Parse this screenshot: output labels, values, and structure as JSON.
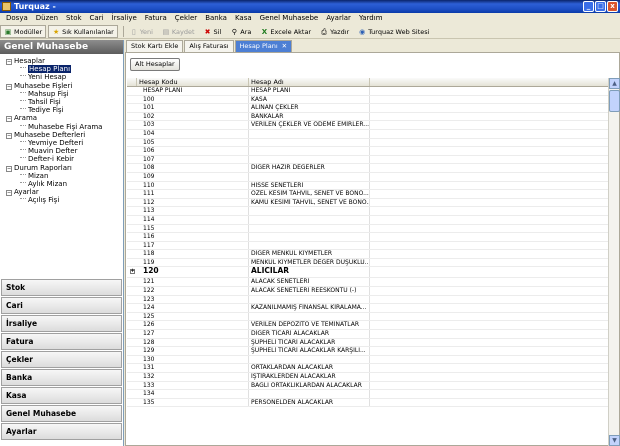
{
  "window": {
    "title": "Turquaz -",
    "buttons": {
      "minimize": "_",
      "maximize": "□",
      "close": "x"
    }
  },
  "menubar": [
    "Dosya",
    "Düzen",
    "Stok",
    "Cari",
    "İrsaliye",
    "Fatura",
    "Çekler",
    "Banka",
    "Kasa",
    "Genel Muhasebe",
    "Ayarlar",
    "Yardım"
  ],
  "toolbar": {
    "modules": "Modüller",
    "frequent": "Sık Kullanılanlar",
    "new": "Yeni",
    "save": "Kaydet",
    "delete": "Sil",
    "search": "Ara",
    "excel": "Excele Aktar",
    "print": "Yazdır",
    "website": "Turquaz Web Sitesi"
  },
  "left_panel": {
    "header": "Genel Muhasebe",
    "tree": [
      {
        "label": "Hesaplar",
        "level": 0,
        "toggle": "−"
      },
      {
        "label": "Hesap Planı",
        "level": 1,
        "selected": true
      },
      {
        "label": "Yeni Hesap",
        "level": 1
      },
      {
        "label": "Muhasebe Fişleri",
        "level": 0,
        "toggle": "−"
      },
      {
        "label": "Mahsup Fişi",
        "level": 1
      },
      {
        "label": "Tahsil Fişi",
        "level": 1
      },
      {
        "label": "Tediye Fişi",
        "level": 1
      },
      {
        "label": "Arama",
        "level": 0,
        "toggle": "−"
      },
      {
        "label": "Muhasebe Fişi Arama",
        "level": 1
      },
      {
        "label": "Muhasebe Defterleri",
        "level": 0,
        "toggle": "−"
      },
      {
        "label": "Yevmiye Defteri",
        "level": 1
      },
      {
        "label": "Muavin Defter",
        "level": 1
      },
      {
        "label": "Defter-i Kebir",
        "level": 1
      },
      {
        "label": "Durum Raporları",
        "level": 0,
        "toggle": "−"
      },
      {
        "label": "Mizan",
        "level": 1
      },
      {
        "label": "Aylık Mizan",
        "level": 1
      },
      {
        "label": "Ayarlar",
        "level": 0,
        "toggle": "−"
      },
      {
        "label": "Açılış Fişi",
        "level": 1
      }
    ],
    "modules": [
      "Stok",
      "Cari",
      "İrsaliye",
      "Fatura",
      "Çekler",
      "Banka",
      "Kasa",
      "Genel Muhasebe",
      "Ayarlar"
    ]
  },
  "doc_tabs": [
    {
      "label": "Stok Kartı Ekle",
      "active": false
    },
    {
      "label": "Alış Faturası",
      "active": false
    },
    {
      "label": "Hesap Planı",
      "active": true,
      "close": "✕"
    }
  ],
  "content": {
    "sub_button": "Alt Hesaplar",
    "columns": [
      "Hesap Kodu",
      "Hesap Adı"
    ],
    "rows": [
      [
        "HESAP PLANI",
        "HESAP PLANI"
      ],
      [
        "100",
        "KASA"
      ],
      [
        "101",
        "ALINAN ÇEKLER"
      ],
      [
        "102",
        "BANKALAR"
      ],
      [
        "103",
        "VERİLEN ÇEKLER VE ÖDEME EMİRLER..."
      ],
      [
        "104",
        ""
      ],
      [
        "105",
        ""
      ],
      [
        "106",
        ""
      ],
      [
        "107",
        ""
      ],
      [
        "108",
        "DİĞER HAZIR DEĞERLER"
      ],
      [
        "109",
        ""
      ],
      [
        "110",
        "HİSSE SENETLERİ"
      ],
      [
        "111",
        "ÖZEL KESİM TAHVİL, SENET VE BONO..."
      ],
      [
        "112",
        "KAMU KESİMİ TAHVİL, SENET VE BONO..."
      ],
      [
        "113",
        ""
      ],
      [
        "114",
        ""
      ],
      [
        "115",
        ""
      ],
      [
        "116",
        ""
      ],
      [
        "117",
        ""
      ],
      [
        "118",
        "DİĞER MENKUL KIYMETLER"
      ],
      [
        "119",
        "MENKUL KIYMETLER DEĞER DÜŞÜKLÜ..."
      ],
      [
        "120",
        "ALICILAR"
      ],
      [
        "121",
        "ALACAK SENETLERİ"
      ],
      [
        "122",
        "ALACAK SENETLERİ REESKONTU (-)"
      ],
      [
        "123",
        ""
      ],
      [
        "124",
        "KAZANILMAMIŞ FİNANSAL KİRALAMA..."
      ],
      [
        "125",
        ""
      ],
      [
        "126",
        "VERİLEN DEPOZİTO VE TEMİNATLAR"
      ],
      [
        "127",
        "DİĞER TİCARİ ALACAKLAR"
      ],
      [
        "128",
        "ŞÜPHELİ TİCARİ ALACAKLAR"
      ],
      [
        "129",
        "ŞÜPHELİ TİCARİ ALACAKLAR KARŞILI..."
      ],
      [
        "130",
        ""
      ],
      [
        "131",
        "ORTAKLARDAN ALACAKLAR"
      ],
      [
        "132",
        "İŞTİRAKLERDEN ALACAKLAR"
      ],
      [
        "133",
        "BAĞLI ORTAKLIKLARDAN ALACAKLAR"
      ],
      [
        "134",
        ""
      ],
      [
        "135",
        "PERSONELDEN ALACAKLAR"
      ]
    ],
    "expanded_row": "120",
    "expander_symbol": "+"
  }
}
